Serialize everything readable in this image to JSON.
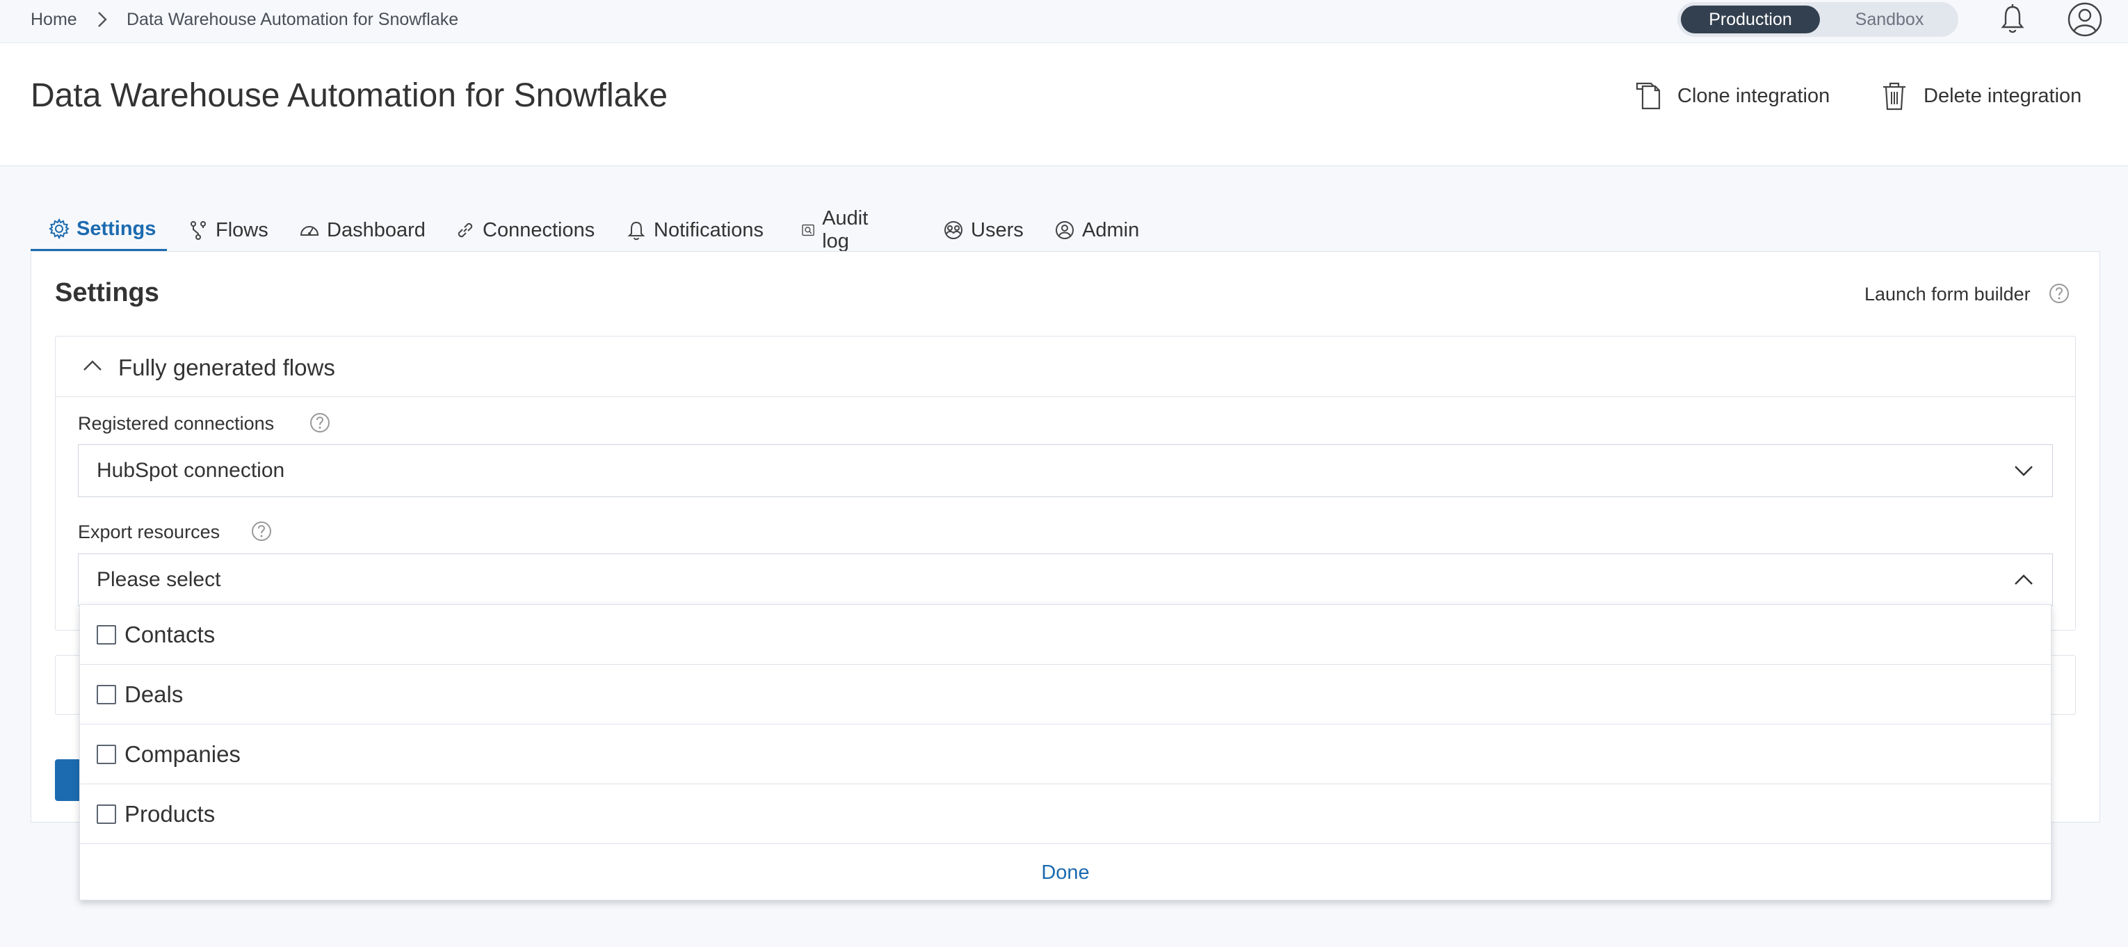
{
  "breadcrumb": {
    "home": "Home",
    "current": "Data Warehouse Automation for Snowflake"
  },
  "environment": {
    "production": "Production",
    "sandbox": "Sandbox",
    "selected": "Production"
  },
  "header": {
    "title": "Data Warehouse Automation for Snowflake",
    "clone_label": "Clone integration",
    "delete_label": "Delete integration"
  },
  "tabs": [
    {
      "label": "Settings",
      "icon": "gear-icon",
      "active": true
    },
    {
      "label": "Flows",
      "icon": "flows-icon"
    },
    {
      "label": "Dashboard",
      "icon": "dashboard-icon"
    },
    {
      "label": "Connections",
      "icon": "link-icon"
    },
    {
      "label": "Notifications",
      "icon": "bell-icon"
    },
    {
      "label": "Audit log",
      "icon": "audit-log-icon"
    },
    {
      "label": "Users",
      "icon": "users-icon"
    },
    {
      "label": "Admin",
      "icon": "admin-icon"
    }
  ],
  "settings": {
    "title": "Settings",
    "launch_form_builder": "Launch form builder",
    "section_title": "Fully generated flows",
    "registered_connections": {
      "label": "Registered connections",
      "value": "HubSpot connection"
    },
    "export_resources": {
      "label": "Export resources",
      "value": "Please select",
      "options": [
        {
          "label": "Contacts",
          "checked": false
        },
        {
          "label": "Deals",
          "checked": false
        },
        {
          "label": "Companies",
          "checked": false
        },
        {
          "label": "Products",
          "checked": false
        }
      ],
      "done_label": "Done"
    }
  },
  "colors": {
    "accent": "#1c6bb0",
    "env_active_bg": "#33404f"
  }
}
